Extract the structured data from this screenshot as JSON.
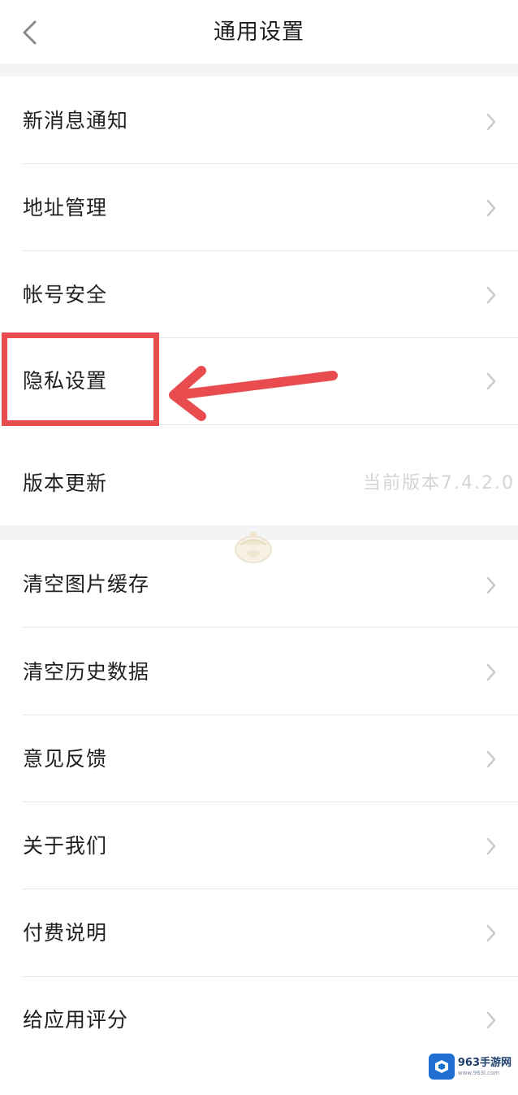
{
  "header": {
    "title": "通用设置",
    "back_icon": "chevron-left-icon"
  },
  "group1": {
    "items": [
      {
        "label": "新消息通知"
      },
      {
        "label": "地址管理"
      },
      {
        "label": "帐号安全"
      },
      {
        "label": "隐私设置"
      },
      {
        "label": "版本更新",
        "value": "当前版本7.4.2.0"
      }
    ]
  },
  "group2": {
    "items": [
      {
        "label": "清空图片缓存"
      },
      {
        "label": "清空历史数据"
      },
      {
        "label": "意见反馈"
      },
      {
        "label": "关于我们"
      },
      {
        "label": "付费说明"
      },
      {
        "label": "给应用评分"
      }
    ]
  },
  "annotation": {
    "highlight_color": "#e84c4f",
    "target": "隐私设置"
  },
  "watermark": {
    "main": "963手游网",
    "sub": "www.963l.com"
  },
  "colors": {
    "background": "#f4f4f4",
    "surface": "#ffffff",
    "text": "#1f1f1f",
    "chevron": "#c8c8c8",
    "version_text": "#d4d4d4"
  }
}
